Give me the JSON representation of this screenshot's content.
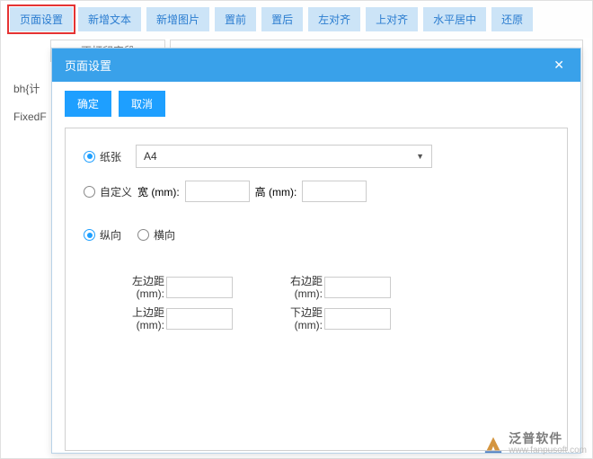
{
  "toolbar": {
    "buttons": [
      "页面设置",
      "新增文本",
      "新增图片",
      "置前",
      "置后",
      "左对齐",
      "上对齐",
      "水平居中",
      "还原"
    ]
  },
  "background": {
    "box_top_label": "不打印字段",
    "line1": "bh{计",
    "line2": "FixedF"
  },
  "dialog": {
    "title": "页面设置",
    "ok": "确定",
    "cancel": "取消",
    "paper_radio": "纸张",
    "paper_select_value": "A4",
    "custom_radio": "自定义",
    "width_label": "宽 (mm):",
    "height_label": "高 (mm):",
    "width_value": "",
    "height_value": "",
    "portrait": "纵向",
    "landscape": "横向",
    "margins": {
      "left_label": "左边距(mm):",
      "right_label": "右边距(mm):",
      "top_label": "上边距(mm):",
      "bottom_label": "下边距(mm):",
      "left": "",
      "right": "",
      "top": "",
      "bottom": ""
    }
  },
  "watermark": {
    "cn": "泛普软件",
    "url": "www.fanpusoft.com"
  }
}
